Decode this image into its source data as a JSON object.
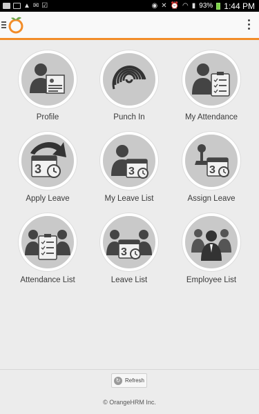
{
  "status_bar": {
    "battery": "93%",
    "time": "1:44 PM"
  },
  "app": {
    "brand_color": "#f28c28"
  },
  "menu": [
    {
      "label": "Profile",
      "icon": "profile-icon"
    },
    {
      "label": "Punch In",
      "icon": "fingerprint-icon"
    },
    {
      "label": "My Attendance",
      "icon": "attendance-clipboard-icon"
    },
    {
      "label": "Apply Leave",
      "icon": "calendar-arrow-icon"
    },
    {
      "label": "My Leave List",
      "icon": "person-calendar-icon"
    },
    {
      "label": "Assign Leave",
      "icon": "stamp-calendar-icon"
    },
    {
      "label": "Attendance List",
      "icon": "people-clipboard-icon"
    },
    {
      "label": "Leave List",
      "icon": "people-calendar-icon"
    },
    {
      "label": "Employee List",
      "icon": "employees-icon"
    }
  ],
  "refresh_label": "Refresh",
  "footer": "© OrangeHRM Inc."
}
